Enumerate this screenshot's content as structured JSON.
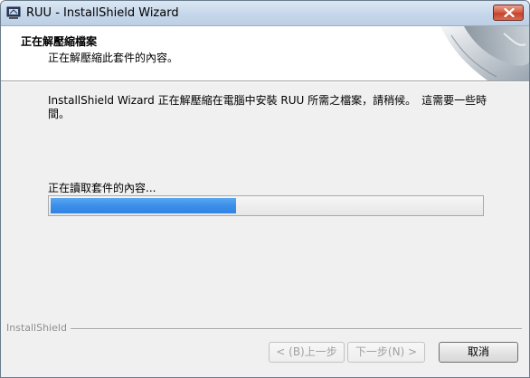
{
  "window": {
    "title": "RUU - InstallShield Wizard"
  },
  "header": {
    "title": "正在解壓縮檔案",
    "subtitle": "正在解壓縮此套件的內容。"
  },
  "main": {
    "message": "InstallShield Wizard 正在解壓縮在電腦中安裝 RUU 所需之檔案，請稍候。　這需要一些時間。",
    "progress_label": "正在讀取套件的內容...",
    "progress_fraction": 0.43
  },
  "footer": {
    "brand": "InstallShield",
    "back_label": "< (B)上一步",
    "next_label": "下一步(N) >",
    "cancel_label": "取消"
  },
  "icons": {
    "app": "installer-computer-icon",
    "close": "close-icon",
    "header_art": "page-curl-graphic"
  },
  "colors": {
    "progress": "#3c8ee8",
    "close_button": "#c4432c",
    "titlebar": "#c6d7ea"
  }
}
